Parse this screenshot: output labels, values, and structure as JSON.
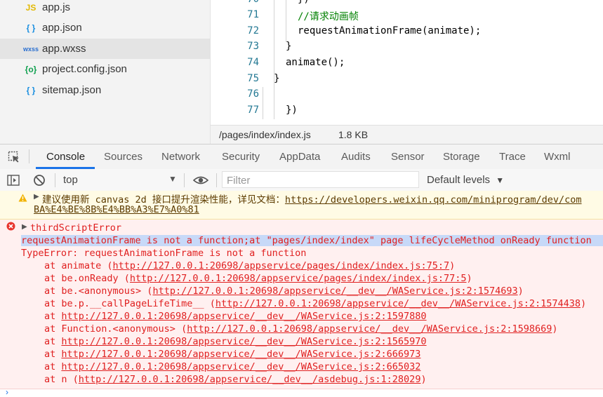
{
  "files": [
    {
      "name": "app.js",
      "icon": "js-file-icon",
      "glyph": "JS",
      "color": "#e2b800"
    },
    {
      "name": "app.json",
      "icon": "json-file-icon",
      "glyph": "{ }",
      "color": "#1a8fe0"
    },
    {
      "name": "app.wxss",
      "icon": "wxss-file-icon",
      "glyph": "wxss",
      "color": "#2a6fd0",
      "selected": true
    },
    {
      "name": "project.config.json",
      "icon": "config-file-icon",
      "glyph": "{o}",
      "color": "#10a050"
    },
    {
      "name": "sitemap.json",
      "icon": "json-file-icon",
      "glyph": "{ }",
      "color": "#1a8fe0"
    }
  ],
  "editor": {
    "lines": [
      {
        "num": "70",
        "code": "})"
      },
      {
        "num": "71",
        "code": "//请求动画帧"
      },
      {
        "num": "72",
        "code": "requestAnimationFrame(animate);"
      },
      {
        "num": "73",
        "code": "}"
      },
      {
        "num": "74",
        "code": "animate();"
      },
      {
        "num": "75",
        "code": "}"
      },
      {
        "num": "76",
        "code": ""
      },
      {
        "num": "77",
        "code": "})"
      }
    ]
  },
  "status": {
    "path": "/pages/index/index.js",
    "size": "1.8 KB"
  },
  "tabs": [
    "Console",
    "Sources",
    "Network",
    "Security",
    "AppData",
    "Audits",
    "Sensor",
    "Storage",
    "Trace",
    "Wxml"
  ],
  "active_tab": "Console",
  "toolbar": {
    "context": "top",
    "filter_placeholder": "Filter",
    "levels": "Default levels"
  },
  "warning": {
    "text": "建议使用新 canvas 2d 接口提升渲染性能，详见文档：",
    "link": "https://developers.weixin.qq.com/miniprogram/dev/com",
    "link2": "BA%E4%BE%8B%E4%BB%A3%E7%A0%81"
  },
  "error": {
    "title": "thirdScriptError",
    "message": "requestAnimationFrame is not a function;at \"pages/index/index\" page lifeCycleMethod onReady function",
    "type": "TypeError: requestAnimationFrame is not a function",
    "stack": [
      {
        "prefix": "at animate (",
        "url": "http://127.0.0.1:20698/appservice/pages/index/index.js:75:7",
        "suffix": ")"
      },
      {
        "prefix": "at be.onReady (",
        "url": "http://127.0.0.1:20698/appservice/pages/index/index.js:77:5",
        "suffix": ")"
      },
      {
        "prefix": "at be.<anonymous> (",
        "url": "http://127.0.0.1:20698/appservice/__dev__/WAService.js:2:1574693",
        "suffix": ")"
      },
      {
        "prefix": "at be.p.__callPageLifeTime__ (",
        "url": "http://127.0.0.1:20698/appservice/__dev__/WAService.js:2:1574438",
        "suffix": ")"
      },
      {
        "prefix": "at ",
        "url": "http://127.0.0.1:20698/appservice/__dev__/WAService.js:2:1597880",
        "suffix": ""
      },
      {
        "prefix": "at Function.<anonymous> (",
        "url": "http://127.0.0.1:20698/appservice/__dev__/WAService.js:2:1598669",
        "suffix": ")"
      },
      {
        "prefix": "at ",
        "url": "http://127.0.0.1:20698/appservice/__dev__/WAService.js:2:1565970",
        "suffix": ""
      },
      {
        "prefix": "at ",
        "url": "http://127.0.0.1:20698/appservice/__dev__/WAService.js:2:666973",
        "suffix": ""
      },
      {
        "prefix": "at ",
        "url": "http://127.0.0.1:20698/appservice/__dev__/WAService.js:2:665032",
        "suffix": ""
      },
      {
        "prefix": "at n (",
        "url": "http://127.0.0.1:20698/appservice/__dev__/asdebug.js:1:28029",
        "suffix": ")"
      }
    ]
  },
  "colors": {
    "accent": "#1a73e8",
    "error_text": "#e02020",
    "warning_bg": "#fffbe5",
    "error_bg": "#fff0f0",
    "comment": "#008000"
  }
}
